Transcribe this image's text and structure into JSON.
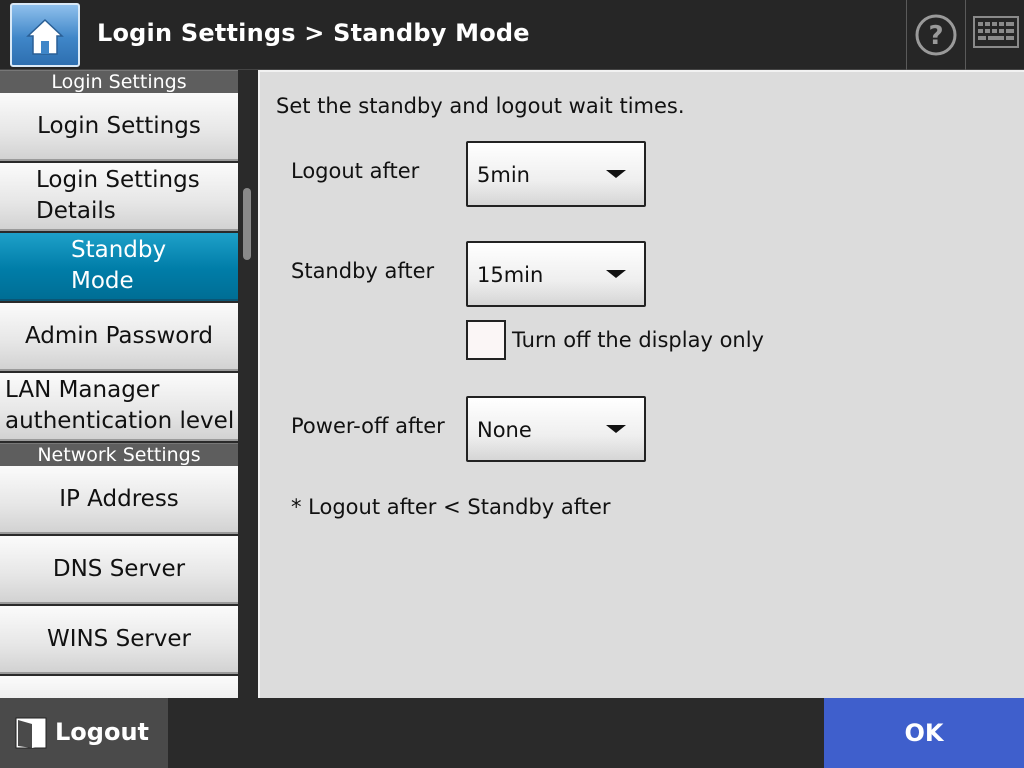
{
  "header": {
    "title": "Login Settings > Standby Mode",
    "home_icon": "home-icon",
    "help_icon": "help-icon",
    "keyboard_icon": "keyboard-icon"
  },
  "sidebar": {
    "section_login": "Login Settings",
    "section_network": "Network Settings",
    "items": {
      "login_settings": "Login Settings",
      "login_settings_details_1": "Login Settings",
      "login_settings_details_2": "Details",
      "standby_mode_1": "Standby",
      "standby_mode_2": "Mode",
      "admin_password": "Admin Password",
      "lan_manager_1": "LAN Manager",
      "lan_manager_2": "authentication level",
      "ip_address": "IP Address",
      "dns_server": "DNS Server",
      "wins_server": "WINS Server"
    },
    "active_item": "Standby Mode"
  },
  "main": {
    "instruction": "Set the standby and logout wait times.",
    "logout_after": {
      "label": "Logout after",
      "value": "5min"
    },
    "standby_after": {
      "label": "Standby after",
      "value": "15min"
    },
    "display_only": {
      "label": "Turn off the display only",
      "checked": false
    },
    "power_off_after": {
      "label": "Power-off after",
      "value": "None"
    },
    "note": "* Logout after < Standby after"
  },
  "footer": {
    "logout_label": "Logout",
    "logout_icon": "logout-icon",
    "ok_label": "OK"
  },
  "colors": {
    "active_item": "#007da8",
    "ok_button": "#3f5fcc",
    "header_bg": "#262626",
    "panel_bg": "#dcdcdc"
  }
}
